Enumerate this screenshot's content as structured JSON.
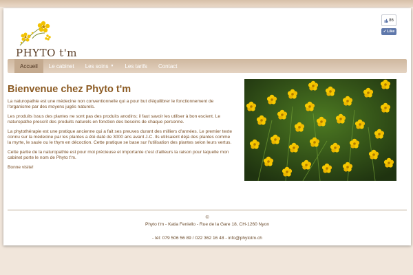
{
  "site": {
    "logo_text": "PHYTO t'm",
    "brand_color": "#8b5a22"
  },
  "social": {
    "like_count": "86",
    "like_label": "Like",
    "thumb_icon": "thumbs-up-icon"
  },
  "nav": {
    "items": [
      {
        "label": "Accueil",
        "active": true
      },
      {
        "label": "Le cabinet"
      },
      {
        "label": "Les soins",
        "dropdown": true
      },
      {
        "label": "Les tarifs"
      },
      {
        "label": "Contact"
      }
    ]
  },
  "main": {
    "title": "Bienvenue chez Phyto t'm",
    "paragraphs": [
      "La naturopathie est une médecine non conventionnelle qui a pour but d'équilibrer le fonctionnement de l'organisme par des moyens jugés naturels.",
      "Les produits issus des plantes ne sont pas des produits anodins; il faut savoir les utiliser à bon escient. Le naturopathe prescrit des produits naturels en fonction des besoins de chaque personne.",
      "La phytothérapie est une pratique ancienne qui a fait ses preuves durant des milliers d'années. Le premier texte connu sur la médecine par les plantes a été daté de 3000 ans avant J-C. Ils utilisaient déjà des plantes comme la myrte, le saule ou le thym en décoction. Cette pratique se base sur l'utilisation des plantes selon leurs vertus.",
      "Cette partie de la naturopathie est pour moi précieuse et importante c'est d'ailleurs la raison pour laquelle mon cabinet porte le nom de Phyto t'm.",
      "Bonne visite!"
    ]
  },
  "footer": {
    "copyright": "©",
    "address": "Phyto t'm - Katia Feniello - Rue de la Gare 18, CH-1260 Nyon",
    "contact": "- tél: 079 506 56 89 / 022 362 16 48 - info@phytotm.ch"
  }
}
